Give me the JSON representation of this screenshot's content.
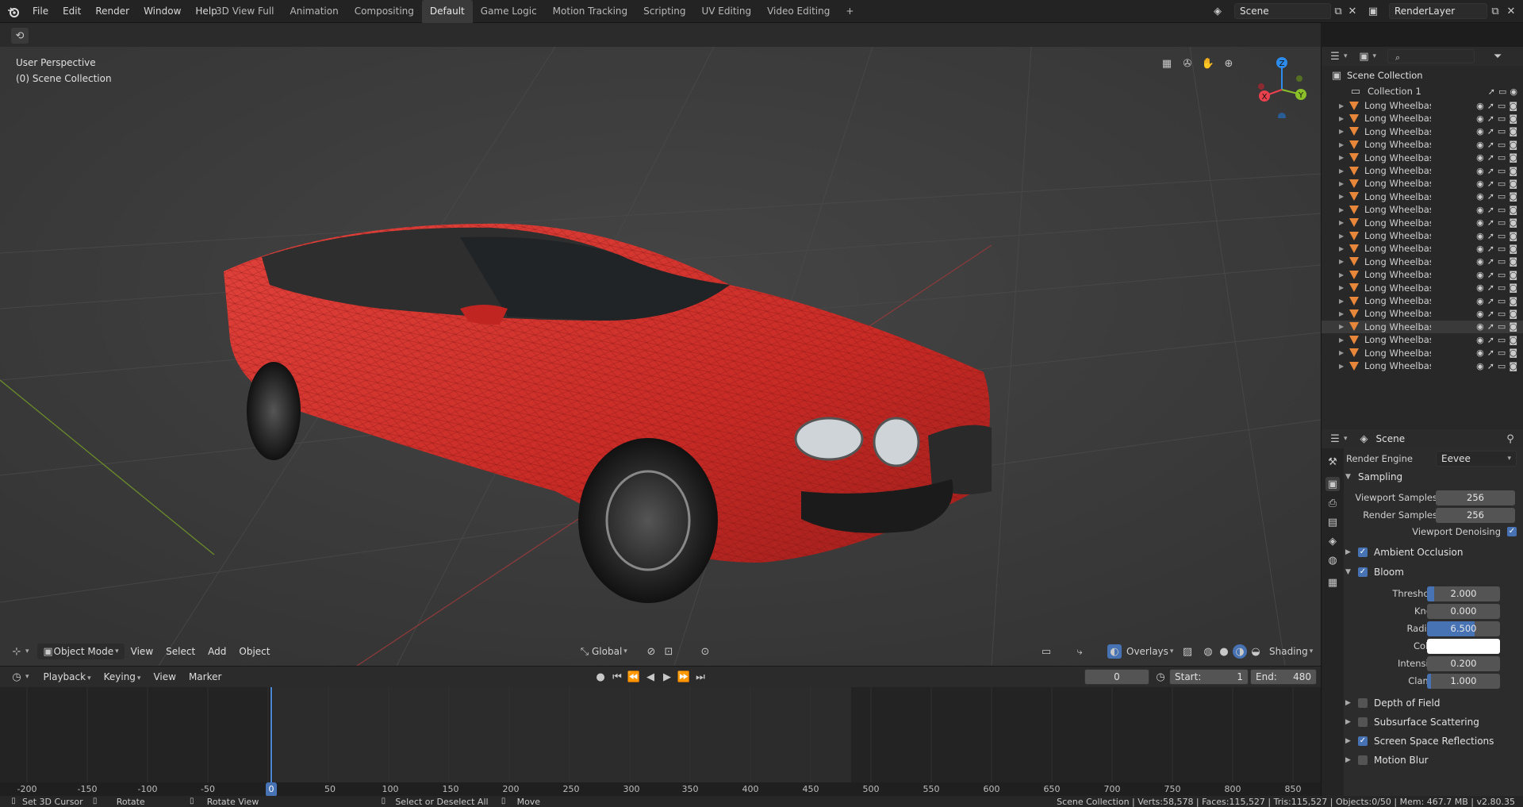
{
  "app": {
    "menu": [
      "File",
      "Edit",
      "Render",
      "Window",
      "Help"
    ],
    "workspace_tabs": [
      "3D View Full",
      "Animation",
      "Compositing",
      "Default",
      "Game Logic",
      "Motion Tracking",
      "Scripting",
      "UV Editing",
      "Video Editing"
    ],
    "active_tab": "Default",
    "add_tab": "+",
    "scene_name": "Scene",
    "render_layer": "RenderLayer"
  },
  "viewport": {
    "perspective": "User Perspective",
    "collection": "(0) Scene Collection",
    "mode": "Object Mode",
    "header_menu": [
      "View",
      "Select",
      "Add",
      "Object"
    ],
    "transform_orientation": "Global",
    "overlays": "Overlays",
    "shading": "Shading",
    "gizmo_axes": {
      "x": "X",
      "y": "Y",
      "z": "Z"
    }
  },
  "timeline": {
    "header_menu": [
      "Playback",
      "Keying",
      "View",
      "Marker"
    ],
    "current_frame": "0",
    "start_label": "Start:",
    "start": "1",
    "end_label": "End:",
    "end": "480",
    "ticks": [
      "-200",
      "-150",
      "-100",
      "-50",
      "0",
      "50",
      "100",
      "150",
      "200",
      "250",
      "300",
      "350",
      "400",
      "450",
      "500",
      "550",
      "600",
      "650",
      "700",
      "750",
      "800",
      "850"
    ]
  },
  "outliner": {
    "root": "Scene Collection",
    "collection": "Collection 1",
    "object_label": "Long Wheelbase Car",
    "object_count": 21,
    "selected_index": 17
  },
  "properties": {
    "context": "Scene",
    "render_engine_label": "Render Engine",
    "render_engine": "Eevee",
    "sampling": {
      "title": "Sampling",
      "viewport_samples_label": "Viewport Samples",
      "viewport_samples": "256",
      "render_samples_label": "Render Samples",
      "render_samples": "256",
      "viewport_denoising": "Viewport Denoising"
    },
    "ambient_occlusion": "Ambient Occlusion",
    "bloom": {
      "title": "Bloom",
      "threshold_label": "Threshold",
      "threshold": "2.000",
      "threshold_fill": 0.1,
      "knee_label": "Knee",
      "knee": "0.000",
      "knee_fill": 0,
      "radius_label": "Radius",
      "radius": "6.500",
      "radius_fill": 0.65,
      "color_label": "Color",
      "color": "#ffffff",
      "intensity_label": "Intensity",
      "intensity": "0.200",
      "intensity_fill": 0,
      "clamp_label": "Clamp",
      "clamp": "1.000",
      "clamp_fill": 0.05
    },
    "depth_of_field": "Depth of Field",
    "subsurface_scattering": "Subsurface Scattering",
    "screen_space_reflections": "Screen Space Reflections",
    "motion_blur": "Motion Blur"
  },
  "status_bar": {
    "set_cursor": "Set 3D Cursor",
    "rotate": "Rotate",
    "rotate_view": "Rotate View",
    "select": "Select or Deselect All",
    "move": "Move",
    "stats": "Scene Collection | Verts:58,578 | Faces:115,527 | Tris:115,527 | Objects:0/50 | Mem: 467.7 MB | v2.80.35"
  },
  "colors": {
    "accent": "#4772b3",
    "car_body": "#d8302b",
    "x_axis": "#e8414d",
    "y_axis": "#8bbf2a",
    "z_axis": "#2d8ceb",
    "object_icon": "#e8873a"
  }
}
